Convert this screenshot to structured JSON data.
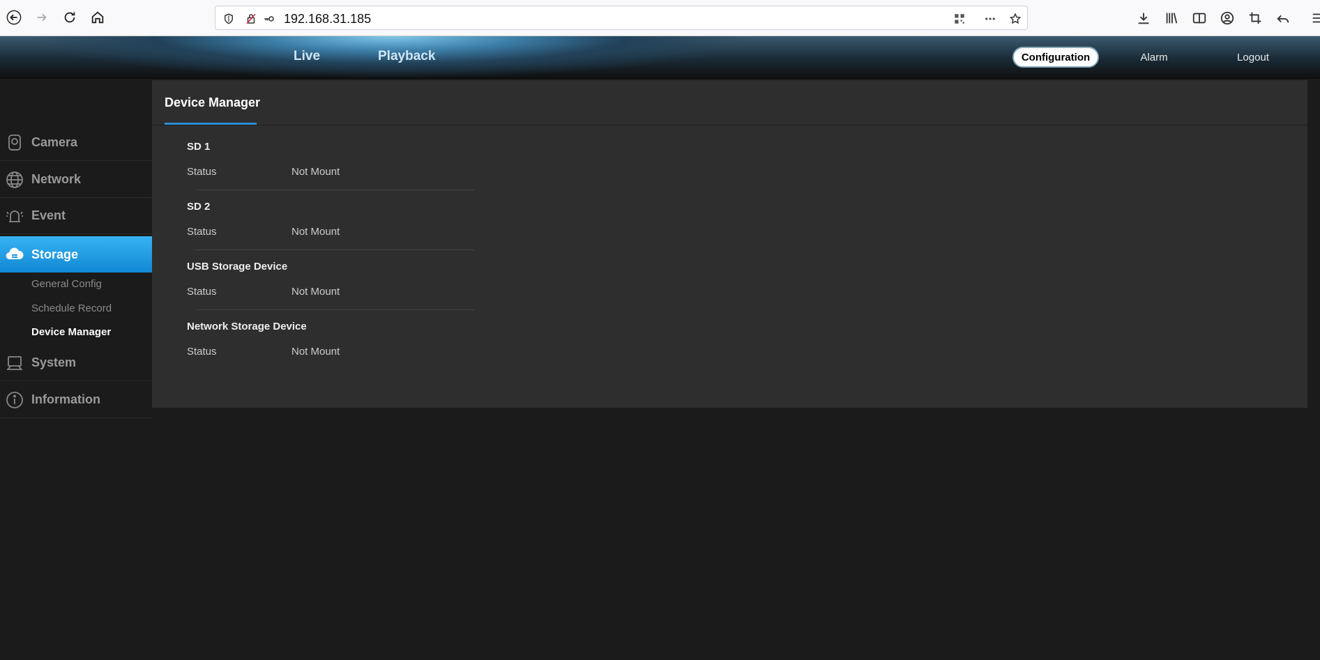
{
  "browser": {
    "url": "192.168.31.185",
    "icons": [
      "back-arrow-icon",
      "forward-arrow-icon",
      "reload-icon",
      "home-icon",
      "shield-icon",
      "insecure-lock-icon",
      "key-icon",
      "qr-code-icon",
      "more-icon",
      "star-icon",
      "download-icon",
      "library-icon",
      "sidebar-icon",
      "account-icon",
      "crop-icon",
      "undo-icon"
    ]
  },
  "header": {
    "tabs": [
      {
        "label": "Live"
      },
      {
        "label": "Playback"
      }
    ],
    "right": [
      {
        "label": "Configuration",
        "active": true
      },
      {
        "label": "Alarm"
      },
      {
        "label": "Logout"
      }
    ]
  },
  "sidebar": {
    "items": [
      {
        "label": "Camera",
        "icon": "camera-icon"
      },
      {
        "label": "Network",
        "icon": "network-globe-icon"
      },
      {
        "label": "Event",
        "icon": "alarm-bell-icon"
      },
      {
        "label": "Storage",
        "icon": "storage-cloud-icon",
        "active": true
      },
      {
        "label": "System",
        "icon": "monitor-icon"
      },
      {
        "label": "Information",
        "icon": "info-icon"
      }
    ],
    "subitems": [
      {
        "label": "General Config"
      },
      {
        "label": "Schedule Record"
      },
      {
        "label": "Device Manager",
        "active": true
      }
    ]
  },
  "panel": {
    "tab": "Device Manager",
    "sections": [
      {
        "title": "SD 1",
        "label": "Status",
        "value": "Not Mount"
      },
      {
        "title": "SD 2",
        "label": "Status",
        "value": "Not Mount"
      },
      {
        "title": "USB Storage Device",
        "label": "Status",
        "value": "Not Mount"
      },
      {
        "title": "Network Storage Device",
        "label": "Status",
        "value": "Not Mount"
      }
    ]
  },
  "colors": {
    "accent": "#1a98e0",
    "panel": "#2e2e2e",
    "background": "#1b1b1b"
  }
}
